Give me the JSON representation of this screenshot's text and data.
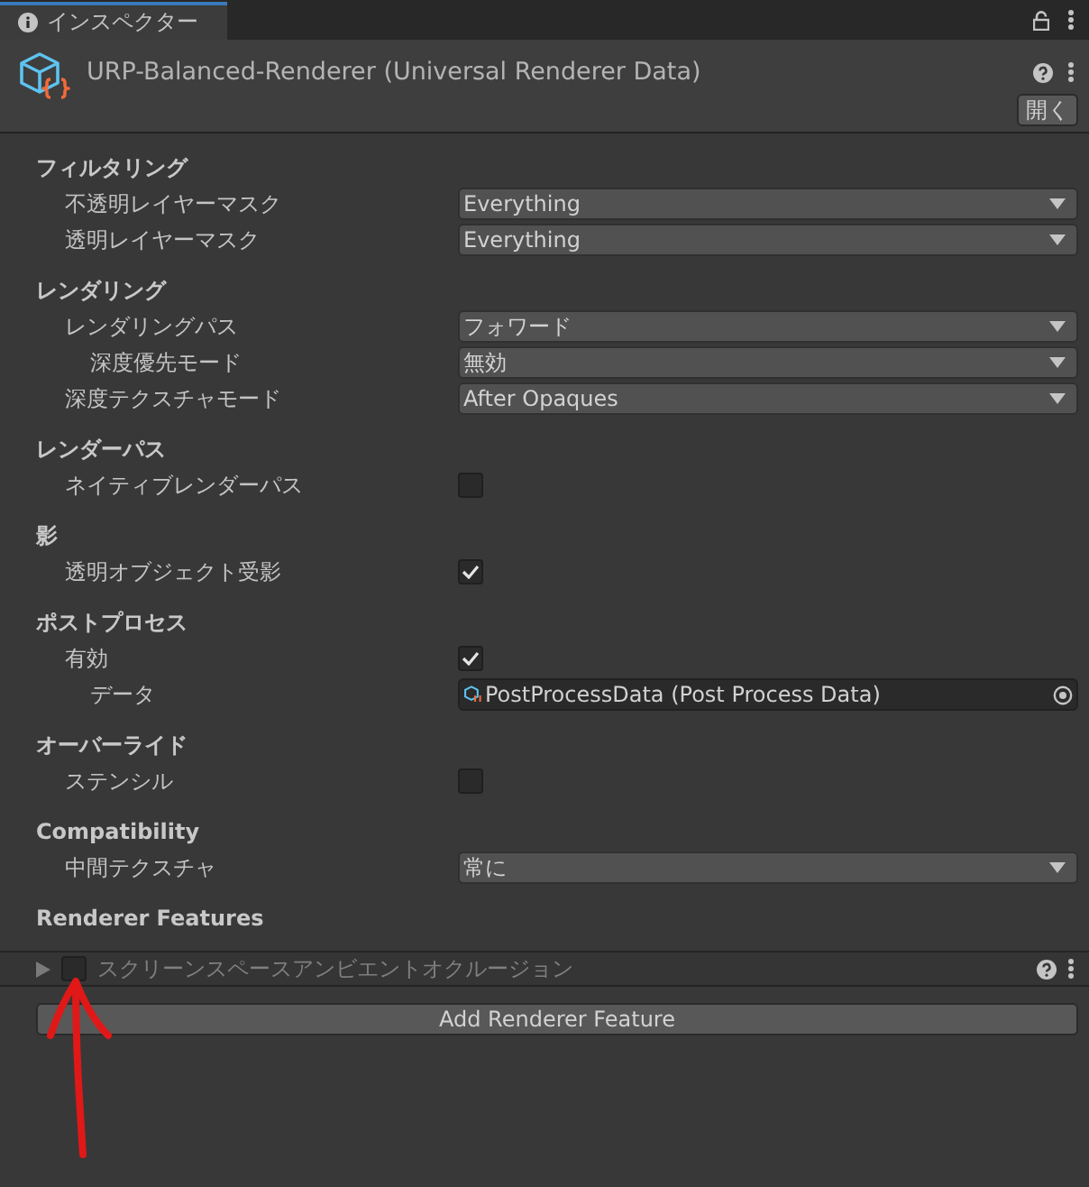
{
  "tab": {
    "label": "インスペクター",
    "selected": true
  },
  "header": {
    "title": "URP-Balanced-Renderer (Universal Renderer Data)",
    "open_button": "開く"
  },
  "sections": [
    {
      "title": "フィルタリング",
      "properties": [
        {
          "label": "不透明レイヤーマスク",
          "kind": "dropdown",
          "value": "Everything"
        },
        {
          "label": "透明レイヤーマスク",
          "kind": "dropdown",
          "value": "Everything"
        }
      ]
    },
    {
      "title": "レンダリング",
      "properties": [
        {
          "label": "レンダリングパス",
          "kind": "dropdown",
          "value": "フォワード",
          "children": [
            {
              "label": "深度優先モード",
              "kind": "dropdown",
              "value": "無効"
            }
          ]
        },
        {
          "label": "深度テクスチャモード",
          "kind": "dropdown",
          "value": "After Opaques"
        }
      ]
    },
    {
      "title": "レンダーパス",
      "properties": [
        {
          "label": "ネイティブレンダーパス",
          "kind": "checkbox",
          "checked": false
        }
      ]
    },
    {
      "title": "影",
      "properties": [
        {
          "label": "透明オブジェクト受影",
          "kind": "checkbox",
          "checked": true
        }
      ]
    },
    {
      "title": "ポストプロセス",
      "properties": [
        {
          "label": "有効",
          "kind": "checkbox",
          "checked": true,
          "children": [
            {
              "label": "データ",
              "kind": "object",
              "value": "PostProcessData (Post Process Data)"
            }
          ]
        }
      ]
    },
    {
      "title": "オーバーライド",
      "properties": [
        {
          "label": "ステンシル",
          "kind": "checkbox",
          "checked": false
        }
      ]
    },
    {
      "title": "Compatibility",
      "properties": [
        {
          "label": "中間テクスチャ",
          "kind": "dropdown",
          "value": "常に"
        }
      ]
    }
  ],
  "renderer_features": {
    "title": "Renderer Features",
    "items": [
      {
        "label": "スクリーンスペースアンビエントオクルージョン",
        "enabled": false,
        "expanded": false
      }
    ],
    "add_button": "Add Renderer Feature"
  }
}
